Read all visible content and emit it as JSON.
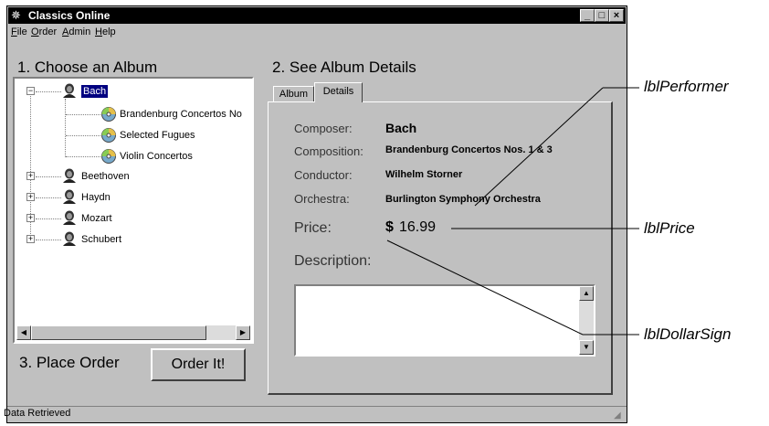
{
  "window": {
    "title": "Classics Online",
    "controls": [
      "_",
      "□",
      "×"
    ]
  },
  "menu": [
    {
      "label": "File"
    },
    {
      "label": "Order"
    },
    {
      "label": "Admin"
    },
    {
      "label": "Help"
    }
  ],
  "sections": {
    "choose": "1. Choose an Album",
    "details": "2. See Album Details",
    "order": "3. Place Order"
  },
  "tree": {
    "composers": [
      {
        "name": "Bach",
        "expanded": true,
        "selected": true,
        "albums": [
          "Brandenburg Concertos No",
          "Selected Fugues",
          "Violin Concertos"
        ]
      },
      {
        "name": "Beethoven",
        "expanded": false
      },
      {
        "name": "Haydn",
        "expanded": false
      },
      {
        "name": "Mozart",
        "expanded": false
      },
      {
        "name": "Schubert",
        "expanded": false
      }
    ],
    "expand_symbol": "+",
    "collapse_symbol": "−"
  },
  "order_button": "Order It!",
  "tabs": [
    {
      "label": "Album",
      "active": false
    },
    {
      "label": "Details",
      "active": true
    }
  ],
  "details": {
    "composer_label": "Composer:",
    "composer_value": "Bach",
    "composition_label": "Composition:",
    "composition_value": "Brandenburg Concertos Nos. 1 & 3",
    "conductor_label": "Conductor:",
    "conductor_value": "Wilhelm Storner",
    "orchestra_label": "Orchestra:",
    "orchestra_value": "Burlington Symphony Orchestra",
    "price_label": "Price:",
    "dollar_sign": "$",
    "price_value": "16.99",
    "description_label": "Description:",
    "description_value": ""
  },
  "status": "Data Retrieved",
  "callouts": {
    "performer": "lblPerformer",
    "price": "lblPrice",
    "dollar": "lblDollarSign"
  },
  "colors": {
    "window_bg": "#c0c0c0",
    "titlebar": "#000000",
    "selection": "#000080"
  }
}
